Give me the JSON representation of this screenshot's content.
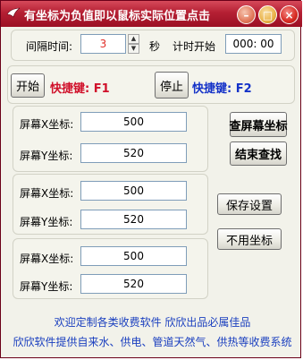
{
  "window": {
    "title": "有坐标为负值即以鼠标实际位置点击",
    "minimize": "–",
    "maximize": "□",
    "close": "×"
  },
  "timer": {
    "interval_label": "间隔时间:",
    "interval_value": "3",
    "unit": "秒",
    "start_label": "计时开始",
    "clock_value": "000: 00"
  },
  "controls": {
    "start_button": "开始",
    "start_hotkey": "快捷键: F1",
    "stop_button": "停止",
    "stop_hotkey": "快捷键: F2"
  },
  "coordinates": [
    {
      "x_label": "屏幕X坐标:",
      "x_value": "500",
      "y_label": "屏幕Y坐标:",
      "y_value": "520"
    },
    {
      "x_label": "屏幕X坐标:",
      "x_value": "500",
      "y_label": "屏幕Y坐标:",
      "y_value": "520"
    },
    {
      "x_label": "屏幕X坐标:",
      "x_value": "500",
      "y_label": "屏幕Y坐标:",
      "y_value": "520"
    }
  ],
  "actions": {
    "find_coords": "查屏幕坐标",
    "end_find": "结束查找",
    "save_settings": "保存设置",
    "no_coords": "不用坐标"
  },
  "footer": {
    "line1": "欢迎定制各类收费软件 欣欣出品必属佳品",
    "line2": "欣欣软件提供自来水、供电、管道天然气、供热等收费系统"
  },
  "colors": {
    "start_hotkey": "#d0102a",
    "stop_hotkey": "#1432c8",
    "interval_value": "#e0302a"
  }
}
